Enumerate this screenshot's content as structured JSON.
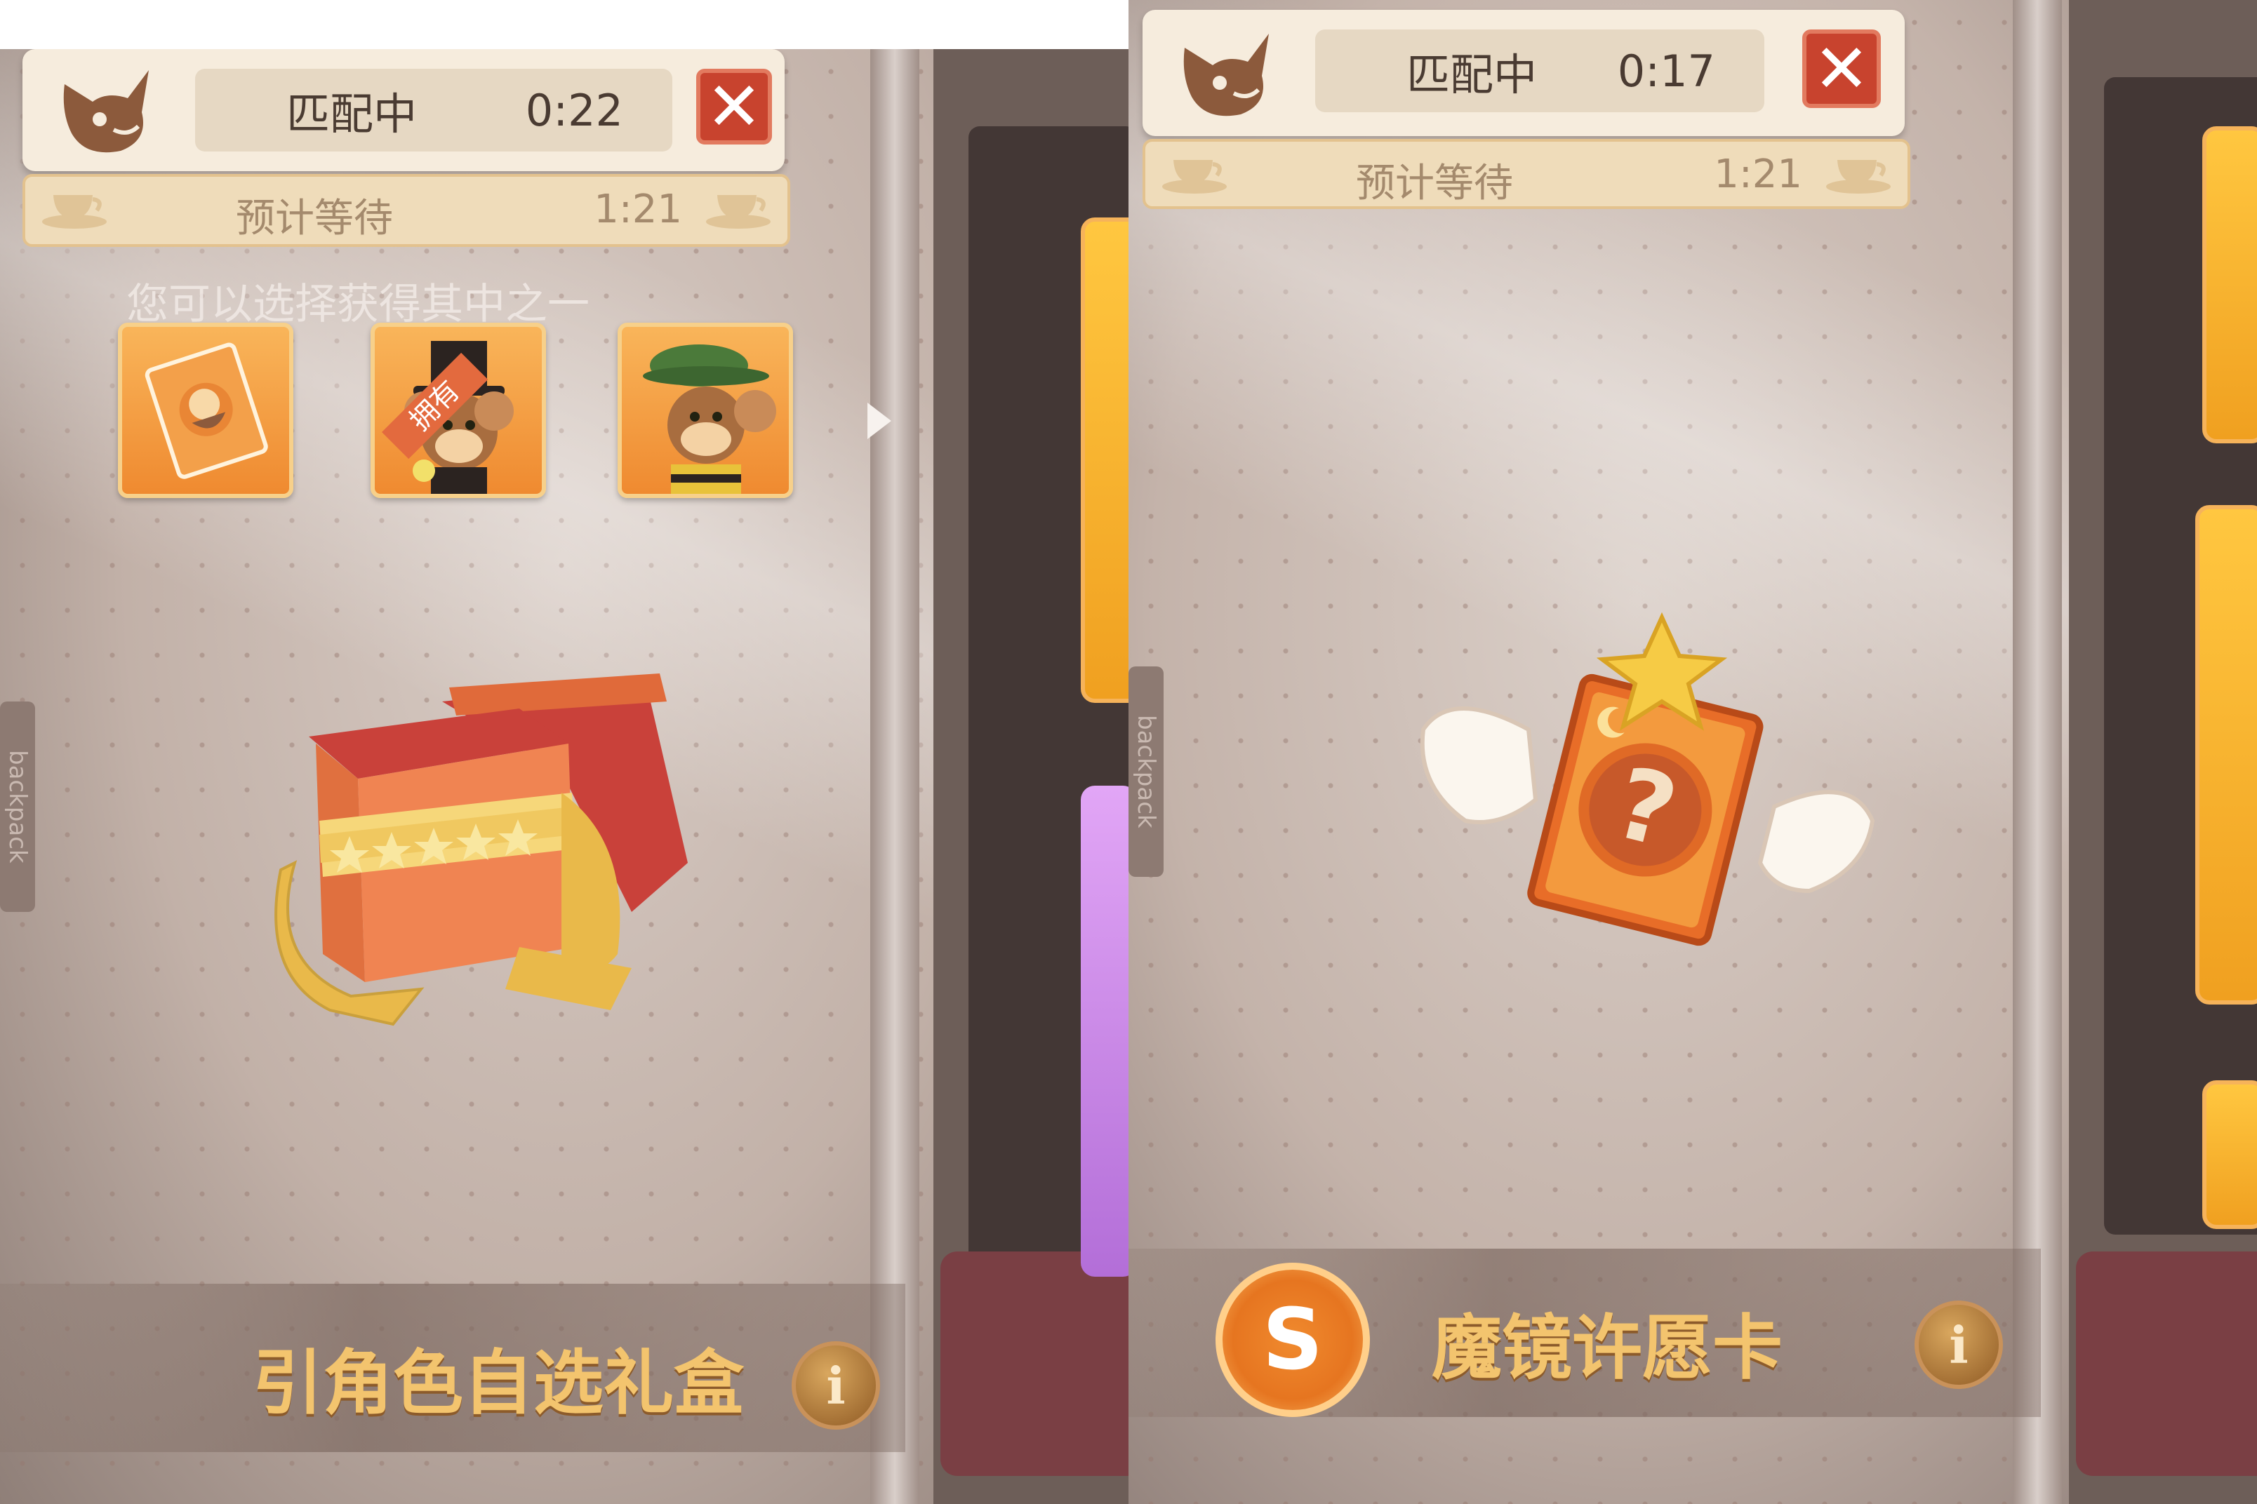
{
  "left": {
    "header": {
      "status_label": "匹配中",
      "elapsed": "0:22",
      "close_symbol": "✕"
    },
    "wait": {
      "label": "预计等待",
      "time": "1:21"
    },
    "subtitle": "您可以选择获得其中之一",
    "choices": [
      {
        "id": "card-item",
        "owned": false
      },
      {
        "id": "magician-jerry",
        "owned": true,
        "tag": "拥有"
      },
      {
        "id": "green-hat-jerry",
        "owned": false
      }
    ],
    "item_title": "引角色自选礼盒",
    "info_symbol": "i",
    "side_tab": "backpack",
    "colors": {
      "accent": "#c8432e",
      "title": "#f3c46e"
    }
  },
  "right": {
    "header": {
      "status_label": "匹配中",
      "elapsed": "0:17",
      "close_symbol": "✕"
    },
    "wait": {
      "label": "预计等待",
      "time": "1:21"
    },
    "currency_symbol": "S",
    "item_title": "魔镜许愿卡",
    "info_symbol": "i",
    "side_tab": "backpack"
  }
}
